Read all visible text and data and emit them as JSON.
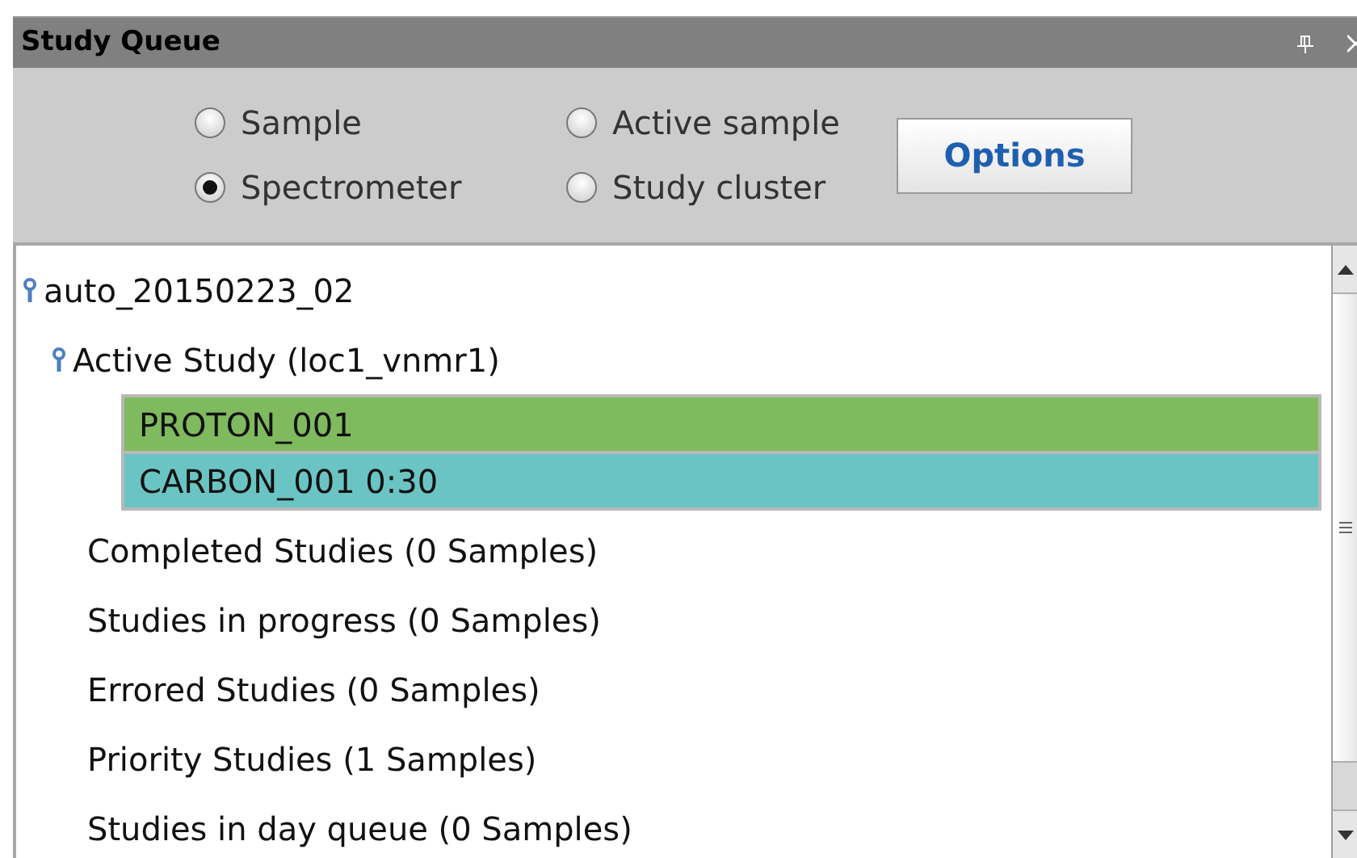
{
  "window": {
    "title": "Study Queue"
  },
  "view_options": [
    {
      "label": "Sample",
      "selected": false
    },
    {
      "label": "Active sample",
      "selected": false
    },
    {
      "label": "Spectrometer",
      "selected": true
    },
    {
      "label": "Study cluster",
      "selected": false
    }
  ],
  "options_button": "Options",
  "tree": {
    "label": "auto_20150223_02",
    "children": [
      {
        "label": "Active Study (loc1_vnmr1)",
        "children": [
          {
            "label": "PROTON_001",
            "color": "#7fba5f"
          },
          {
            "label": "CARBON_001 0:30",
            "color": "#6bc4c4"
          }
        ]
      },
      {
        "label": "Completed Studies (0 Samples)"
      },
      {
        "label": "Studies in progress (0 Samples)"
      },
      {
        "label": "Errored Studies (0 Samples)"
      },
      {
        "label": "Priority Studies (1 Samples)"
      },
      {
        "label": "Studies in day queue (0 Samples)"
      }
    ]
  }
}
